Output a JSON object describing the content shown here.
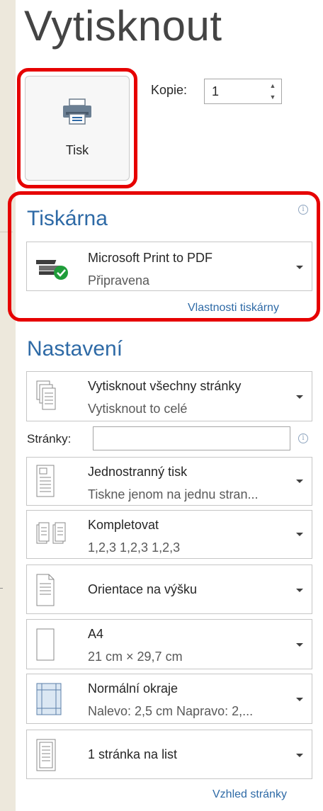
{
  "title": "Vytisknout",
  "print_button": {
    "label": "Tisk"
  },
  "copies": {
    "label": "Kopie:",
    "value": "1"
  },
  "printer": {
    "heading": "Tiskárna",
    "name": "Microsoft Print to PDF",
    "status": "Připravena",
    "properties_link": "Vlastnosti tiskárny"
  },
  "settings": {
    "heading": "Nastavení",
    "print_range": {
      "primary": "Vytisknout všechny stránky",
      "secondary": "Vytisknout to celé"
    },
    "pages": {
      "label": "Stránky:",
      "value": ""
    },
    "sides": {
      "primary": "Jednostranný tisk",
      "secondary": "Tiskne jenom na jednu stran..."
    },
    "collate": {
      "primary": "Kompletovat",
      "secondary": "1,2,3   1,2,3   1,2,3"
    },
    "orientation": {
      "primary": "Orientace na výšku"
    },
    "paper": {
      "primary": "A4",
      "secondary": "21 cm × 29,7 cm"
    },
    "margins": {
      "primary": "Normální okraje",
      "secondary": "Nalevo: 2,5 cm   Napravo: 2,..."
    },
    "pages_per_sheet": {
      "primary": "1 stránka na list"
    },
    "page_setup_link": "Vzhled stránky"
  },
  "colors": {
    "accent": "#2e6aa6",
    "highlight": "#e60000",
    "ready_green": "#1f9d3a"
  }
}
